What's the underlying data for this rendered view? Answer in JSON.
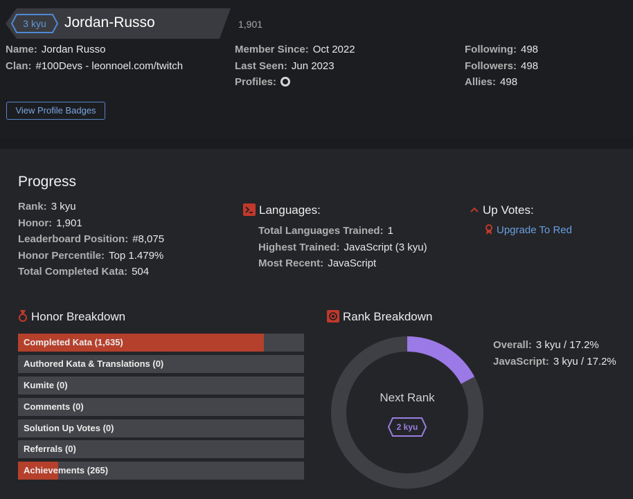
{
  "profile": {
    "rank_badge": "3 kyu",
    "username": "Jordan-Russo",
    "honor": "1,901",
    "col1": [
      {
        "label": "Name:",
        "value": "Jordan Russo"
      },
      {
        "label": "Clan:",
        "value": "#100Devs - leonnoel.com/twitch"
      }
    ],
    "col2": [
      {
        "label": "Member Since:",
        "value": "Oct 2022"
      },
      {
        "label": "Last Seen:",
        "value": "Jun 2023"
      },
      {
        "label": "Profiles:",
        "icon": "github-icon"
      }
    ],
    "col3": [
      {
        "label": "Following:",
        "value": "498"
      },
      {
        "label": "Followers:",
        "value": "498"
      },
      {
        "label": "Allies:",
        "value": "498"
      }
    ],
    "badges_button": "View Profile Badges"
  },
  "progress": {
    "title": "Progress",
    "stats": [
      {
        "label": "Rank:",
        "value": "3 kyu"
      },
      {
        "label": "Honor:",
        "value": "1,901"
      },
      {
        "label": "Leaderboard Position:",
        "value": "#8,075"
      },
      {
        "label": "Honor Percentile:",
        "value": "Top 1.479%"
      },
      {
        "label": "Total Completed Kata:",
        "value": "504"
      }
    ]
  },
  "languages": {
    "title": "Languages:",
    "icon": "terminal-icon",
    "stats": [
      {
        "label": "Total Languages Trained:",
        "value": "1"
      },
      {
        "label": "Highest Trained:",
        "value": "JavaScript (3 kyu)"
      },
      {
        "label": "Most Recent:",
        "value": "JavaScript"
      }
    ]
  },
  "upvotes": {
    "title": "Up Votes:",
    "icon": "chevron-up-icon",
    "link": "Upgrade To Red",
    "link_icon": "ribbon-icon"
  },
  "honor_breakdown": {
    "title": "Honor Breakdown",
    "icon": "medal-icon",
    "color_fill": "#b5402c",
    "items": [
      {
        "label": "Completed Kata (1,635)",
        "fill": 0.86
      },
      {
        "label": "Authored Kata & Translations (0)",
        "fill": 0
      },
      {
        "label": "Kumite (0)",
        "fill": 0
      },
      {
        "label": "Comments (0)",
        "fill": 0
      },
      {
        "label": "Solution Up Votes (0)",
        "fill": 0
      },
      {
        "label": "Referrals (0)",
        "fill": 0
      },
      {
        "label": "Achievements (265)",
        "fill": 0.14
      }
    ]
  },
  "rank_breakdown": {
    "title": "Rank Breakdown",
    "icon": "target-icon",
    "overall": {
      "label": "Overall:",
      "value": "3 kyu / 17.2%"
    },
    "language": {
      "label": "JavaScript:",
      "value": "3 kyu / 17.2%"
    },
    "progress_fraction": 0.172,
    "progress_color": "#9b79e6",
    "next_rank_label": "Next Rank",
    "next_rank_badge": "2 kyu"
  }
}
